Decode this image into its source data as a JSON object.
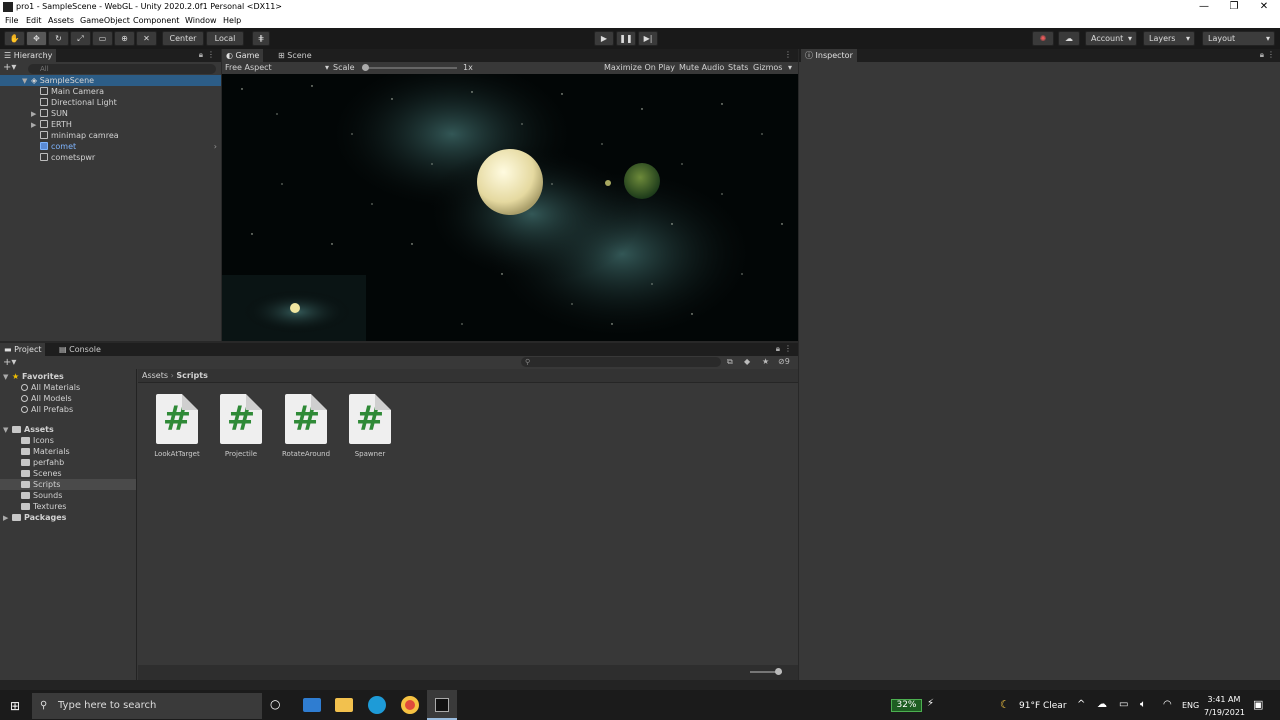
{
  "window": {
    "title": "pro1 - SampleScene - WebGL - Unity 2020.2.0f1 Personal <DX11>"
  },
  "menu": [
    "File",
    "Edit",
    "Assets",
    "GameObject",
    "Component",
    "Window",
    "Help"
  ],
  "toolbar": {
    "center": "Center",
    "local": "Local",
    "account": "Account",
    "layers": "Layers",
    "layout": "Layout"
  },
  "hierarchy": {
    "tab": "Hierarchy",
    "search_placeholder": "All",
    "scene": "SampleScene",
    "items": [
      "Main Camera",
      "Directional Light",
      "SUN",
      "ERTH",
      "minimap camrea",
      "comet",
      "cometspwr"
    ]
  },
  "game": {
    "tab_game": "Game",
    "tab_scene": "Scene",
    "aspect": "Free Aspect",
    "scale_label": "Scale",
    "scale_value": "1x",
    "maximize": "Maximize On Play",
    "mute": "Mute Audio",
    "stats": "Stats",
    "gizmos": "Gizmos"
  },
  "inspector": {
    "tab": "Inspector"
  },
  "project": {
    "tab_project": "Project",
    "tab_console": "Console",
    "favorites": "Favorites",
    "fav_items": [
      "All Materials",
      "All Models",
      "All Prefabs"
    ],
    "assets": "Assets",
    "asset_folders": [
      "Icons",
      "Materials",
      "perfahb",
      "Scenes",
      "Scripts",
      "Sounds",
      "Textures"
    ],
    "packages": "Packages",
    "breadcrumb_root": "Assets",
    "breadcrumb_leaf": "Scripts",
    "files": [
      "LookAtTarget",
      "Projectile",
      "RotateAround",
      "Spawner"
    ],
    "hidden_count": "9"
  },
  "taskbar": {
    "search_placeholder": "Type here to search",
    "battery": "32%",
    "weather": "91°F  Clear",
    "lang": "ENG",
    "time": "3:41 AM",
    "date": "7/19/2021"
  }
}
